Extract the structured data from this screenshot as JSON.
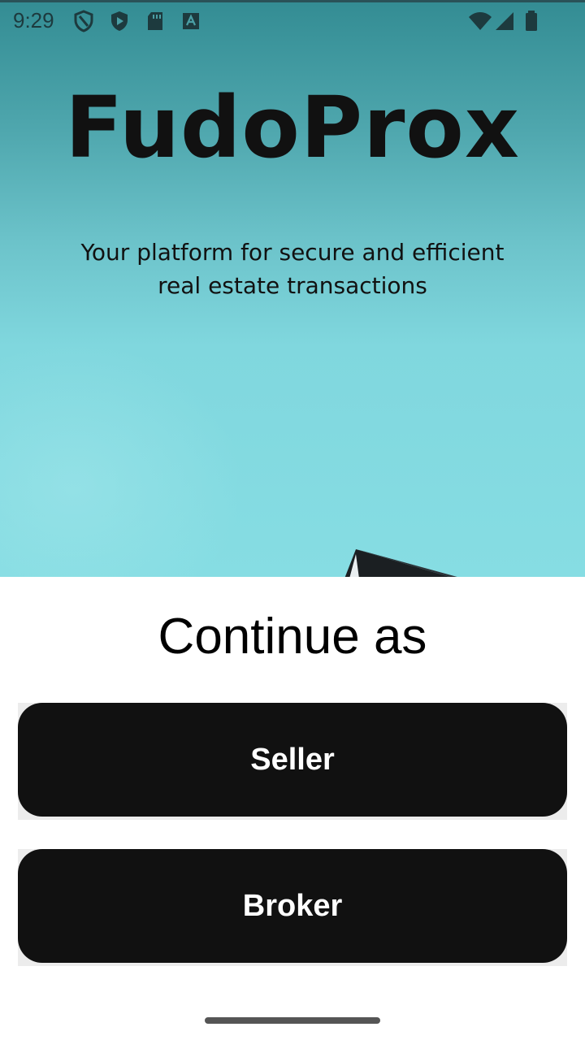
{
  "status_bar": {
    "time": "9:29",
    "left_icons": [
      "shield-outline-icon",
      "shield-play-icon",
      "sd-card-icon",
      "keyboard-a-icon"
    ],
    "right_icons": [
      "wifi-icon",
      "cellular-signal-icon",
      "battery-icon"
    ]
  },
  "hero": {
    "title": "FudoProx",
    "tagline": "Your platform for secure and efficient real estate transactions"
  },
  "sheet": {
    "heading": "Continue as",
    "buttons": {
      "seller": "Seller",
      "broker": "Broker"
    }
  },
  "colors": {
    "hero_top": "#338c93",
    "hero_bottom": "#86dde3",
    "button": "#111111",
    "button_text": "#ffffff"
  }
}
